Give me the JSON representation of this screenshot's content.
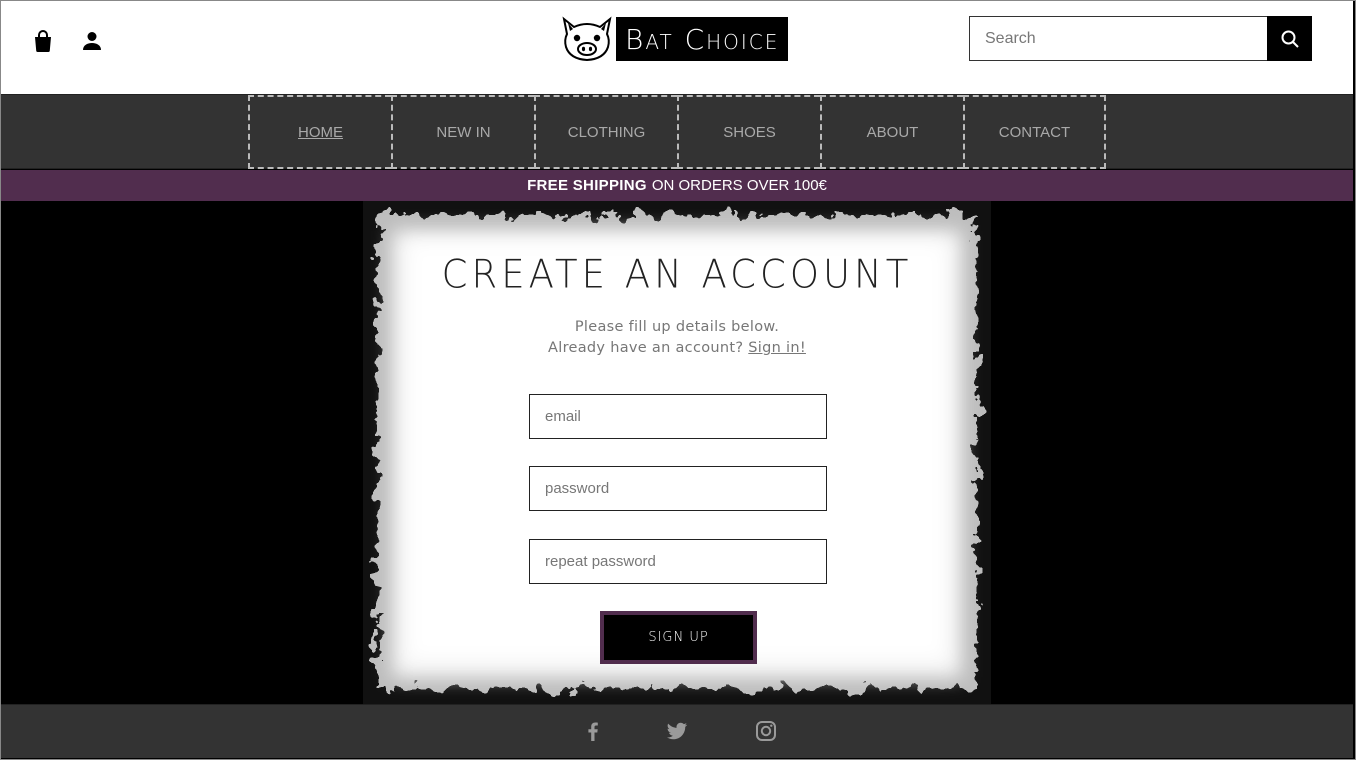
{
  "header": {
    "icons": [
      "shopping-bag-icon",
      "user-icon",
      "search-icon"
    ],
    "brand": "Bat Choice",
    "search_placeholder": "Search"
  },
  "nav": {
    "items": [
      {
        "label": "HOME",
        "active": true
      },
      {
        "label": "NEW IN"
      },
      {
        "label": "CLOTHING"
      },
      {
        "label": "SHOES"
      },
      {
        "label": "ABOUT"
      },
      {
        "label": "CONTACT"
      }
    ]
  },
  "banner": {
    "bold": "FREE SHIPPING",
    "text": "ON ORDERS OVER 100€"
  },
  "form": {
    "title": "CREATE AN ACCOUNT",
    "line1": "Please fill up details below.",
    "line2": "Already have an account?",
    "signin_link": "Sign in!",
    "email_placeholder": "email",
    "password_placeholder": "password",
    "repeat_placeholder": "repeat password",
    "submit_label": "SIGN UP"
  },
  "footer": {
    "social": [
      "facebook-icon",
      "twitter-icon",
      "instagram-icon"
    ]
  },
  "colors": {
    "accent": "#512d4e",
    "nav_bg": "#333333",
    "nav_text": "#a9a9a9"
  }
}
